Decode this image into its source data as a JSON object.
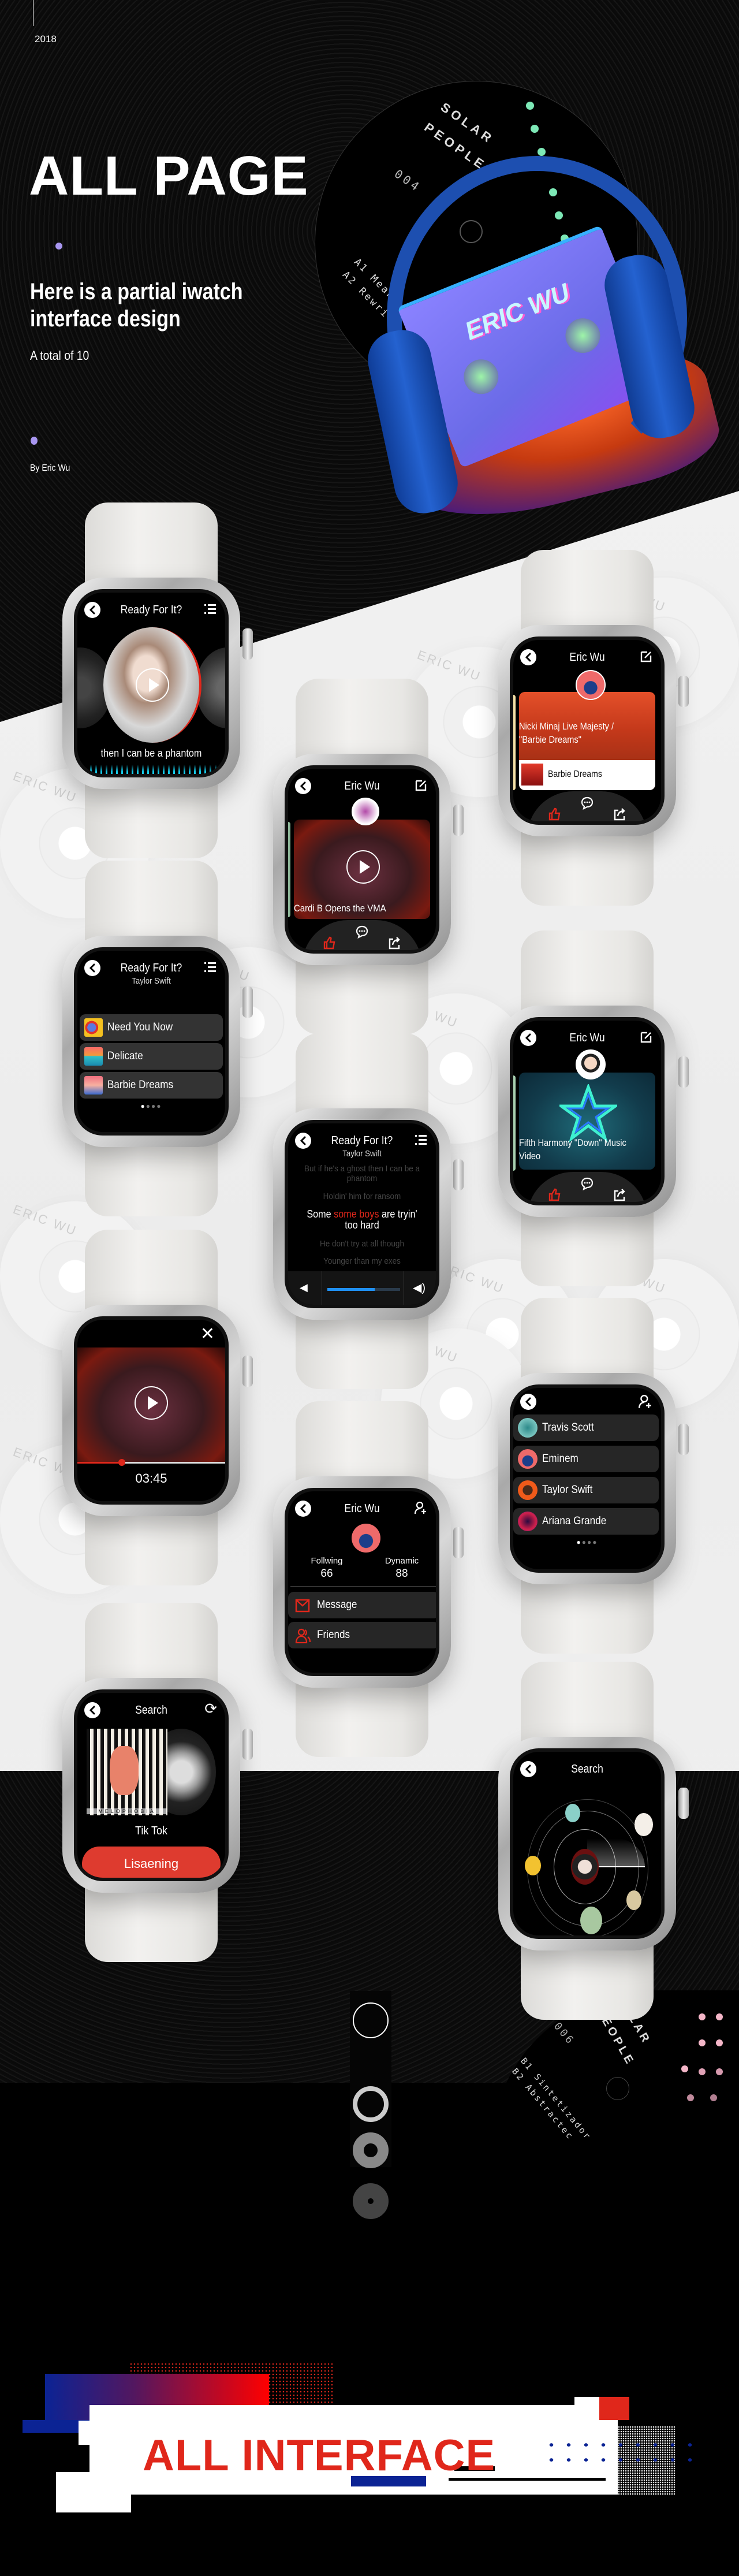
{
  "intro": {
    "year": "2018",
    "title": "ALL PAGE",
    "subtitle_line1": "Here is a partial iwatch",
    "subtitle_line2": "interface design",
    "count": "A total of 10",
    "author": "By Eric Wu"
  },
  "artwork": {
    "cassette_logo": "ERIC WU",
    "record_top": {
      "label1": "SOLAR",
      "label2": "PEOPLE",
      "number": "004",
      "track1": "A1 Meant to",
      "track2": "A2 Rewrite"
    },
    "record_bottom": {
      "label1": "SOLAR",
      "label2": "PEOPLE",
      "number": "006",
      "track1": "B1 Sintetizador",
      "track2": "B2 Abstractec"
    },
    "watermark": "ERIC WU"
  },
  "colors": {
    "accent_red": "#e0271b",
    "progress_blue": "#1f8ff0",
    "equalizer_cyan": "#17c9e8",
    "banner_blue": "#0b2394"
  },
  "player": {
    "title": "Ready For It?",
    "lyric": "then I can be a phantom",
    "icons": [
      "back-icon",
      "list-icon",
      "play-icon"
    ]
  },
  "feed_cardi": {
    "title": "Eric Wu",
    "caption": "Cardi B Opens the VMA",
    "icons": [
      "back-icon",
      "edit-icon",
      "like-icon",
      "comment-icon",
      "share-icon"
    ]
  },
  "feed_nicki": {
    "title": "Eric Wu",
    "caption": "Nicki Minaj Live Majesty / \"Barbie Dreams\"",
    "track": "Barbie Dreams"
  },
  "playlist": {
    "title": "Ready For It?",
    "artist": "Taylor Swift",
    "items": [
      "Need You Now",
      "Delicate",
      "Barbie Dreams"
    ],
    "page": 1,
    "pages": 4
  },
  "lyrics": {
    "title": "Ready For It?",
    "artist": "Taylor Swift",
    "line1": "But if he's a ghost then I can be a phantom",
    "line2": "Holdin' him for ransom",
    "current_pre": "Some ",
    "current_hl": "some boys",
    "current_post": " are tryin' too hard",
    "line4": "He don't try at all though",
    "line5": "Younger than my exes",
    "volume_percent": 65
  },
  "feed_fifth": {
    "title": "Eric Wu",
    "caption": "Fifth Harmony \"Down\" Music Video"
  },
  "video": {
    "time": "03:45",
    "progress_percent": 30
  },
  "profile": {
    "title": "Eric Wu",
    "following_label": "Follwing",
    "following": "66",
    "dynamic_label": "Dynamic",
    "dynamic": "88",
    "menu": [
      "Message",
      "Friends"
    ]
  },
  "friends": {
    "items": [
      "Travis Scott",
      "Eminem",
      "Taylor Swift",
      "Ariana Grande"
    ],
    "page": 1,
    "pages": 4
  },
  "search_listen": {
    "title": "Search",
    "song": "Tik Tok",
    "button": "Lisaening",
    "album_text": "MELOPHOBIA"
  },
  "search_orbit": {
    "title": "Search"
  },
  "footer": {
    "title": "ALL INTERFACE"
  }
}
